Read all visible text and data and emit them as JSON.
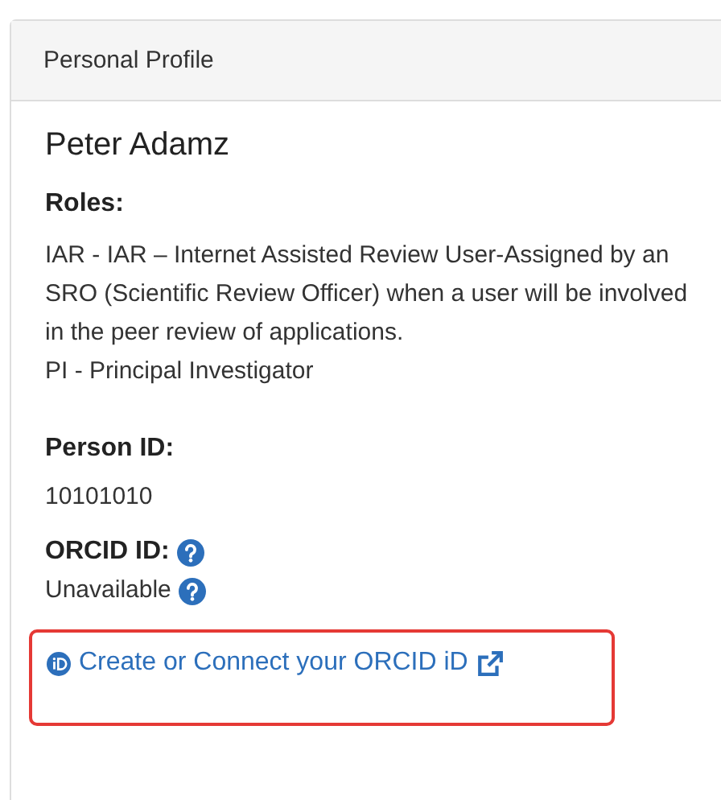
{
  "panel": {
    "title": "Personal Profile"
  },
  "name": "Peter Adamz",
  "roles": {
    "label": "Roles:",
    "items": [
      "IAR - IAR – Internet Assisted Review User-Assigned by an SRO (Scientific Review Officer) when a user will be involved in the peer review of applications.",
      "PI - Principal Investigator"
    ]
  },
  "person_id": {
    "label": "Person ID:",
    "value": "10101010"
  },
  "orcid": {
    "label": "ORCID ID:",
    "value": "Unavailable",
    "link": "Create or Connect your ORCID iD",
    "highlighted": true
  }
}
